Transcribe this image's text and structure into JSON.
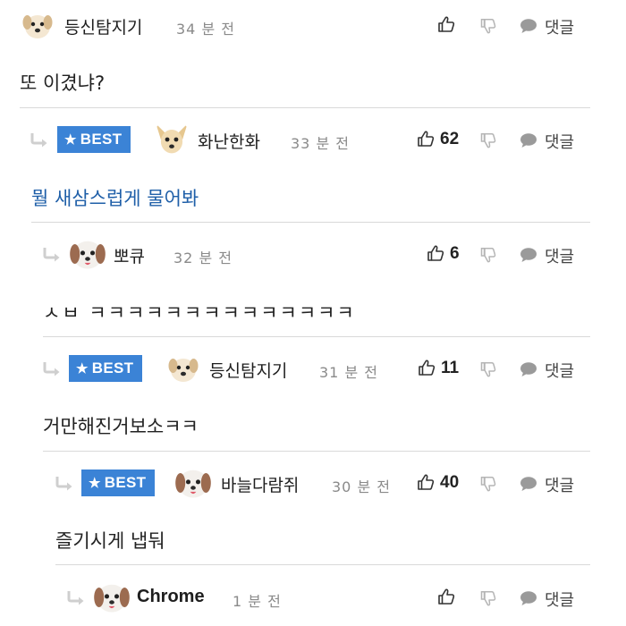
{
  "ui": {
    "reply_label": "댓글",
    "best_label": "BEST"
  },
  "comments": [
    {
      "username": "등신탐지기",
      "time": "34 분 전",
      "likes": "",
      "content": "또 이겼냐?",
      "best": false
    },
    {
      "username": "화난한화",
      "time": "33 분 전",
      "likes": "62",
      "content": "뭘 새삼스럽게 물어봐",
      "best": true
    },
    {
      "username": "뽀큐",
      "time": "32 분 전",
      "likes": "6",
      "content": "ㅅㅂ ㅋㅋㅋㅋㅋㅋㅋㅋㅋㅋㅋㅋㅋㅋ",
      "best": false
    },
    {
      "username": "등신탐지기",
      "time": "31 분 전",
      "likes": "11",
      "content": "거만해진거보소ㅋㅋ",
      "best": true
    },
    {
      "username": "바늘다람쥐",
      "time": "30 분 전",
      "likes": "40",
      "content": "즐기시게 냅둬",
      "best": true
    },
    {
      "username": "Chrome",
      "time": "1 분 전",
      "likes": "",
      "content": "",
      "best": false
    }
  ],
  "colors": {
    "best_badge": "#3b83d6",
    "highlight_text": "#1f5fa8",
    "divider": "#d9d9d9"
  }
}
